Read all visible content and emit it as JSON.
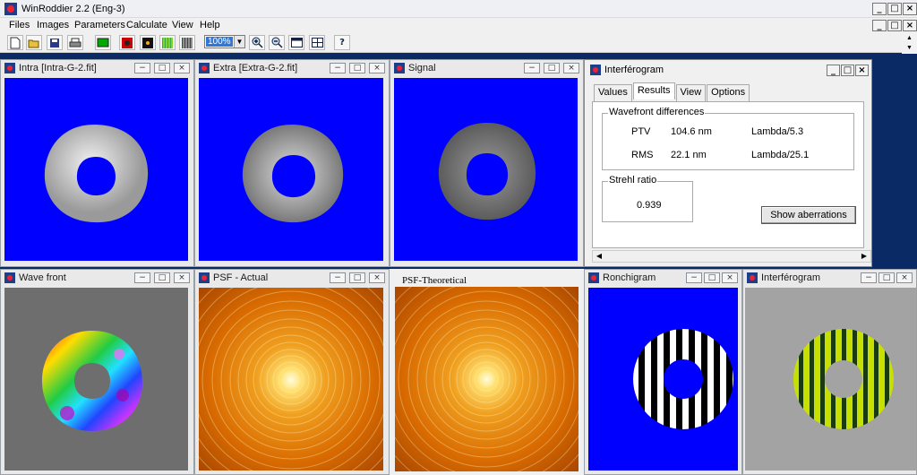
{
  "app": {
    "title": "WinRoddier 2.2 (Eng-3)"
  },
  "menu": [
    "Files",
    "Images",
    "Parameters",
    "Calculate",
    "View",
    "Help"
  ],
  "toolbar": {
    "zoom_value": "100%",
    "help_label": "?"
  },
  "windows": {
    "intra": {
      "title": "Intra [Intra-G-2.fit]"
    },
    "extra": {
      "title": "Extra [Extra-G-2.fit]"
    },
    "signal": {
      "title": "Signal"
    },
    "wavefront": {
      "title": "Wave front"
    },
    "psf_actual": {
      "title": "PSF - Actual"
    },
    "psf_theoretical": {
      "title": "PSF-Theoretical"
    },
    "ronchigram": {
      "title": "Ronchigram"
    },
    "interferogram2": {
      "title": "Interférogram"
    }
  },
  "interferogram_panel": {
    "title": "Interférogram",
    "tabs": [
      "Values",
      "Results",
      "View",
      "Options"
    ],
    "active_tab": "Results",
    "wavefront_group": "Wavefront differences",
    "ptv_label": "PTV",
    "ptv_value": "104.6 nm",
    "ptv_lambda": "Lambda/5.3",
    "rms_label": "RMS",
    "rms_value": "22.1 nm",
    "rms_lambda": "Lambda/25.1",
    "strehl_group": "Strehl ratio",
    "strehl_value": "0.939",
    "show_aberrations": "Show aberrations"
  },
  "colors": {
    "blue_bg": "#0000ff",
    "mdi_bg": "#0a2a66",
    "gray_bg": "#6e6e6e",
    "light_gray_bg": "#a3a3a3"
  }
}
